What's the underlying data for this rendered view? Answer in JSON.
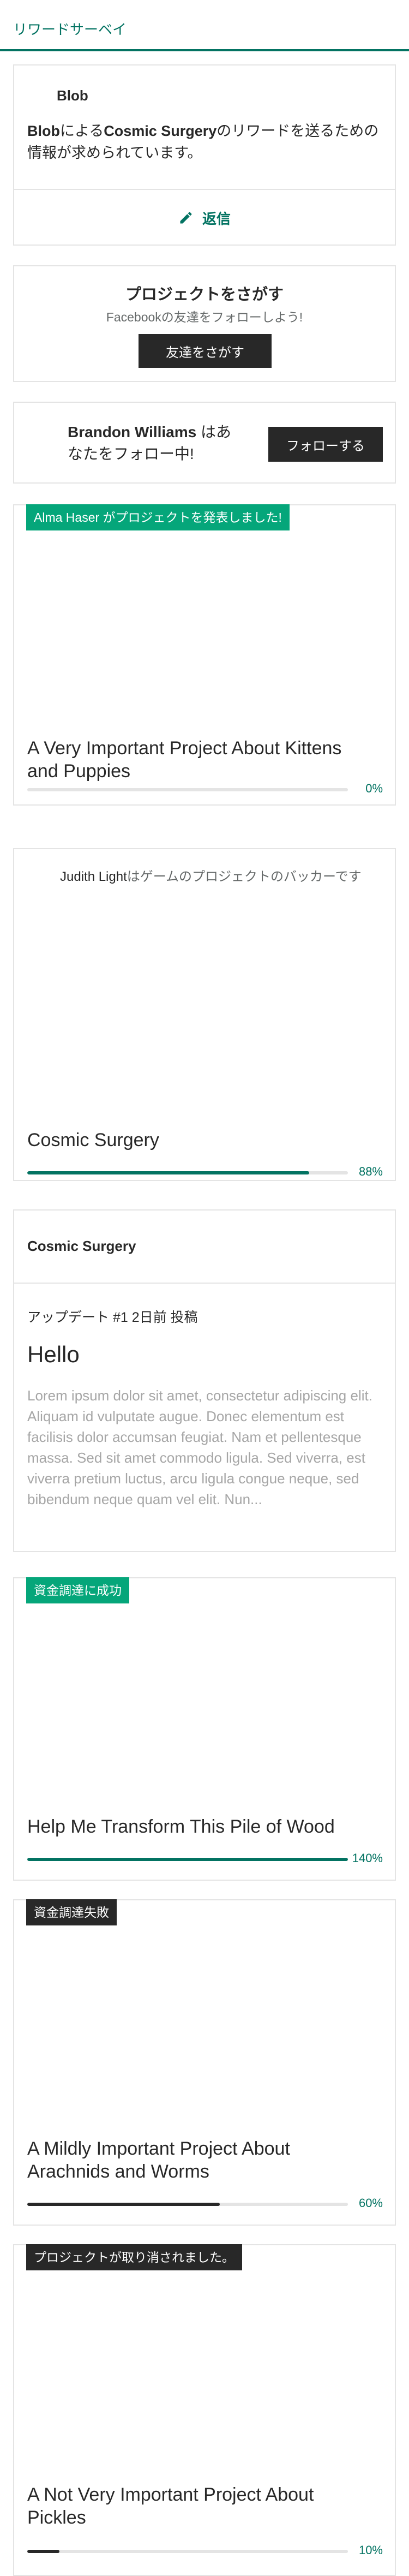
{
  "header": {
    "title": "リワードサーベイ"
  },
  "message": {
    "sender": "Blob",
    "sender_name": "Blob",
    "text_mid": "による",
    "project": "Cosmic Surgery",
    "text_end": "のリワードを送るための情報が求められています。",
    "reply_label": "返信"
  },
  "find_friends": {
    "title": "プロジェクトをさがす",
    "subtitle": "Facebookの友達をフォローしよう!",
    "button": "友達をさがす"
  },
  "follow": {
    "name": "Brandon Williams",
    "text": " はあなたをフォロー中!",
    "button": "フォローする"
  },
  "projects": [
    {
      "badge": "Alma Haser がプロジェクトを発表しました!",
      "title": "A Very Important Project About Kittens and Puppies",
      "progress_label": "0%",
      "progress": 0
    },
    {
      "backer_name": "Judith Light",
      "backer_text": "はゲームのプロジェクトのバッカーです",
      "title": "Cosmic Surgery",
      "progress_label": "88%",
      "progress": 0.88
    },
    {
      "badge": "資金調達に成功",
      "title": "Help Me Transform This Pile of Wood",
      "progress_label": "140%",
      "progress": 1.0
    },
    {
      "badge": "資金調達失敗",
      "title": "A Mildly Important Project About Arachnids and Worms",
      "progress_label": "60%",
      "progress": 0.6
    },
    {
      "badge": "プロジェクトが取り消されました。",
      "title": "A Not Very Important Project About Pickles",
      "progress_label": "10%",
      "progress": 0.1
    }
  ],
  "update": {
    "project": "Cosmic Surgery",
    "meta": "アップデート #1 2日前 投稿",
    "title": "Hello",
    "body": "Lorem ipsum dolor sit amet, consectetur adipiscing elit. Aliquam id vulputate augue. Donec elementum est facilisis dolor accumsan feugiat. Nam et pellentesque massa. Sed sit amet commodo ligula. Sed viverra, est viverra pretium luctus, arcu ligula congue neque, sed bibendum neque quam vel elit. Nun..."
  },
  "colors": {
    "accent": "#037362",
    "badge_green": "#05a67a",
    "dark": "#282828",
    "border": "#e4e4e4"
  }
}
